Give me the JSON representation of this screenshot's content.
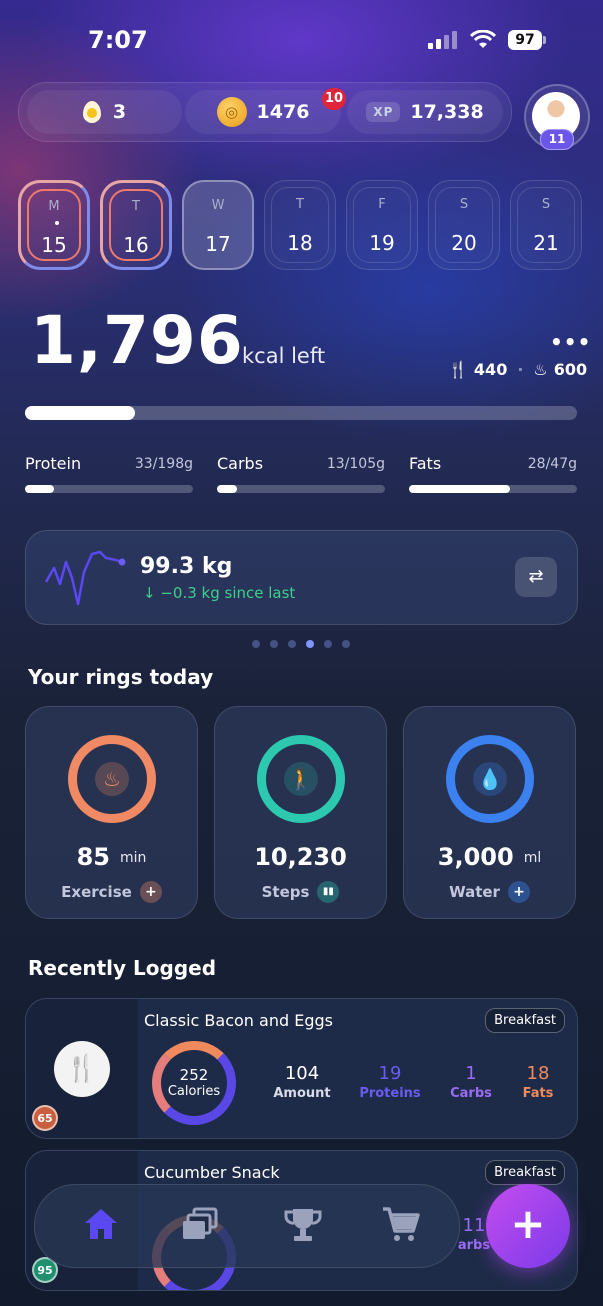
{
  "status": {
    "time": "7:07",
    "battery": "97"
  },
  "stats": {
    "eggs": "3",
    "coins": "1476",
    "coin_badge": "10",
    "xp_label": "XP",
    "xp": "17,338",
    "level": "11"
  },
  "days": [
    {
      "letter": "M",
      "num": "15"
    },
    {
      "letter": "T",
      "num": "16"
    },
    {
      "letter": "W",
      "num": "17"
    },
    {
      "letter": "T",
      "num": "18"
    },
    {
      "letter": "F",
      "num": "19"
    },
    {
      "letter": "S",
      "num": "20"
    },
    {
      "letter": "S",
      "num": "21"
    }
  ],
  "calories": {
    "left": "1,796",
    "label": "kcal left",
    "eaten": "440",
    "burned": "600",
    "progress": 0.2
  },
  "macros": [
    {
      "name": "Protein",
      "value": "33/198g",
      "progress": 0.17
    },
    {
      "name": "Carbs",
      "value": "13/105g",
      "progress": 0.12
    },
    {
      "name": "Fats",
      "value": "28/47g",
      "progress": 0.6
    }
  ],
  "weight": {
    "value": "99.3 kg",
    "diff": "↓ −0.3 kg since last"
  },
  "rings_title": "Your rings today",
  "rings": [
    {
      "value": "85",
      "unit": "min",
      "label": "Exercise",
      "color": "#ef8a64",
      "button": "+"
    },
    {
      "value": "10,230",
      "unit": "",
      "label": "Steps",
      "color": "#2cc9b0",
      "button": "▮"
    },
    {
      "value": "3,000",
      "unit": "ml",
      "label": "Water",
      "color": "#3b82f0",
      "button": "+"
    }
  ],
  "recent_title": "Recently Logged",
  "logged": [
    {
      "name": "Classic Bacon and Eggs",
      "meal": "Breakfast",
      "score": "65",
      "calories": "252",
      "calories_label": "Calories",
      "amount": "104",
      "amount_label": "Amount",
      "proteins": "19",
      "proteins_label": "Proteins",
      "carbs": "1",
      "carbs_label": "Carbs",
      "fats": "18",
      "fats_label": "Fats"
    },
    {
      "name": "Cucumber Snack",
      "meal": "Breakfast",
      "score": "95",
      "carbs_partial": "11",
      "carbs_label_partial": "arbs"
    }
  ],
  "nav": {
    "fab": "+"
  },
  "colors": {
    "protein": "#6b5cf0",
    "carbs": "#9a6cf2",
    "fats": "#f08a5d"
  }
}
